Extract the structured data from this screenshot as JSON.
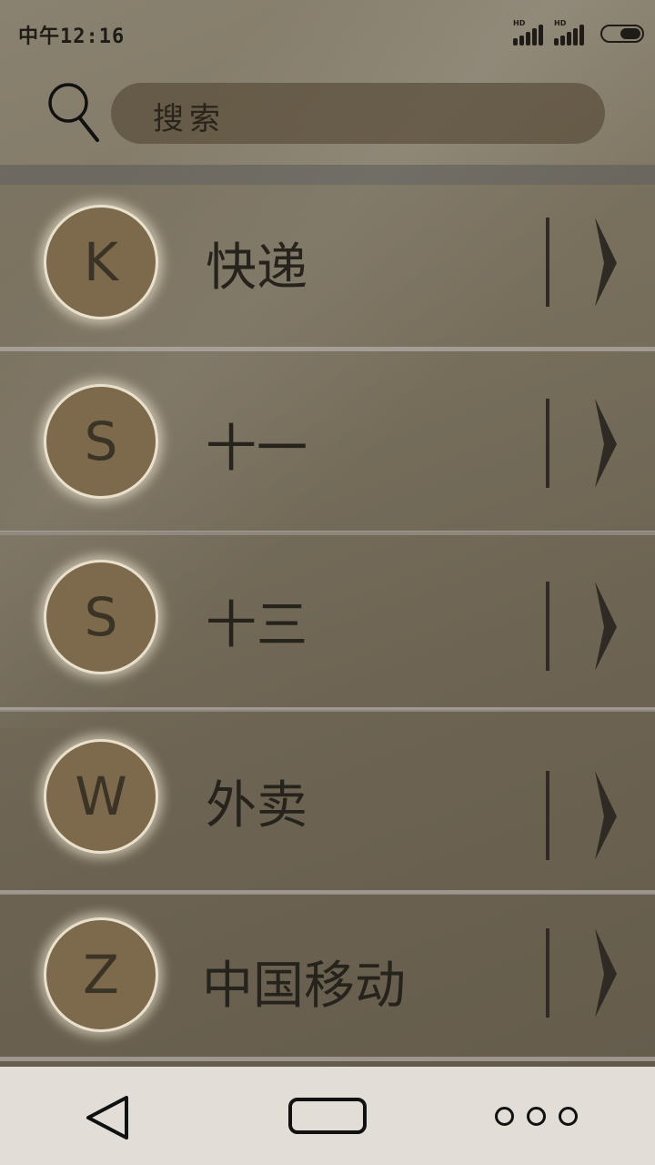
{
  "status_bar": {
    "time": "中午12:16",
    "hd_label_1": "HD",
    "hd_label_2": "HD"
  },
  "search": {
    "placeholder": "搜索"
  },
  "contacts": [
    {
      "initial": "K",
      "name": "快递"
    },
    {
      "initial": "S",
      "name": "十一"
    },
    {
      "initial": "S",
      "name": "十三"
    },
    {
      "initial": "W",
      "name": "外卖"
    },
    {
      "initial": "Z",
      "name": "中国移动"
    }
  ],
  "icons": {
    "search": "search-icon",
    "chevron": "chevron-right-icon",
    "back": "back-triangle-icon",
    "home": "home-rect-icon",
    "more": "more-dots-icon"
  },
  "colors": {
    "avatar_fill": "#7d6a4c",
    "avatar_ring": "#e9e1cc",
    "nav_bar": "#e2ddd6",
    "search_box": "#5a4e3a"
  }
}
